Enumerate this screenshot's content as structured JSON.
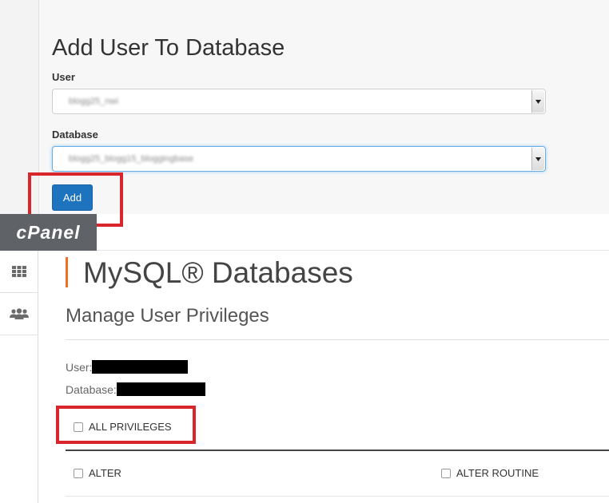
{
  "add_user_form": {
    "heading": "Add User To Database",
    "user_label": "User",
    "user_value": "blogg25_nwi",
    "database_label": "Database",
    "database_value": "blogg25_blogg15_bloggingbase",
    "add_button_label": "Add"
  },
  "header": {
    "logo_text": "cPanel"
  },
  "sidebar": {
    "items": [
      {
        "icon": "grid-icon"
      },
      {
        "icon": "users-icon"
      }
    ]
  },
  "page": {
    "title": "MySQL® Databases",
    "section_title": "Manage User Privileges",
    "user_label": "User:",
    "database_label": "Database:"
  },
  "privileges": {
    "all_label": "ALL PRIVILEGES",
    "items": [
      "ALTER",
      "ALTER ROUTINE"
    ]
  },
  "colors": {
    "accent_orange": "#f26d21",
    "button_blue": "#1e73be",
    "highlight_red": "#d9262d",
    "logo_bar": "#5f6367"
  }
}
